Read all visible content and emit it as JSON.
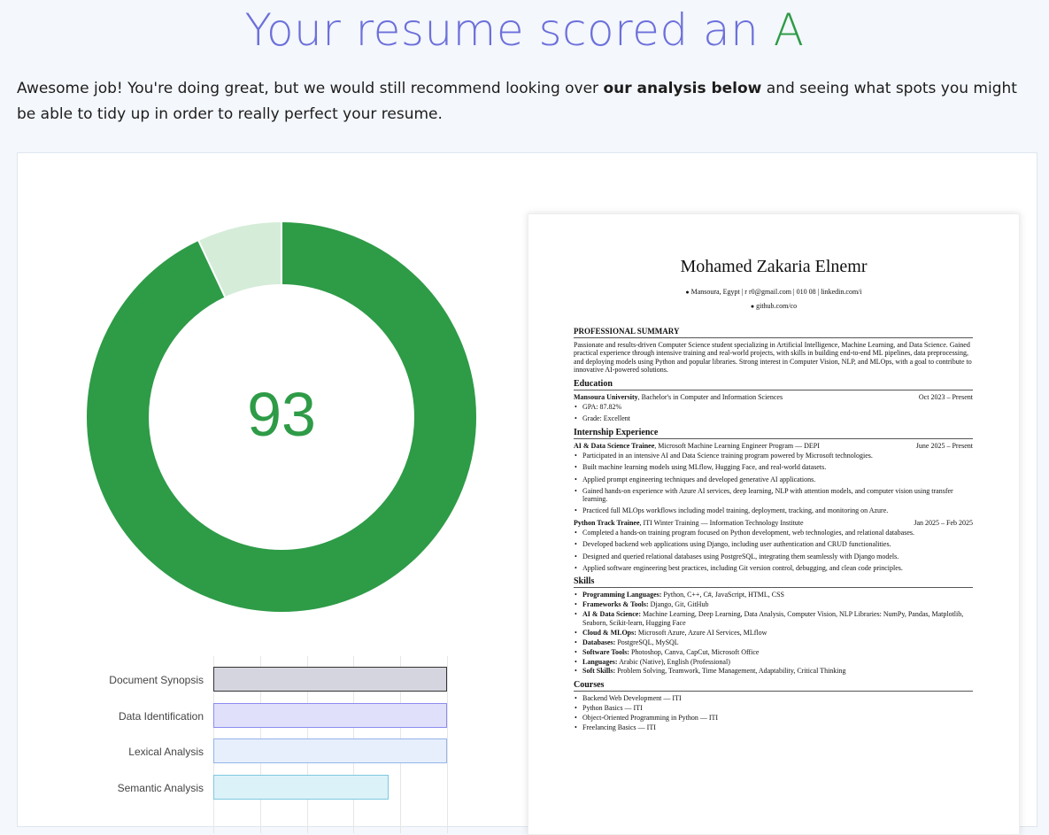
{
  "header": {
    "title_prefix": "Your resume scored an ",
    "grade": "A",
    "intro_before": "Awesome job! You're doing great, but we would still recommend looking over ",
    "intro_bold": "our analysis below",
    "intro_after": " and seeing what spots you might be able to tidy up in order to really perfect your resume."
  },
  "score": {
    "value": "93",
    "fraction": 0.93,
    "colors": {
      "fill": "#2e9b47",
      "remainder": "#d5ecd9"
    }
  },
  "bar_chart": {
    "chart_data": {
      "type": "bar",
      "orientation": "horizontal",
      "categories": [
        "Document Synopsis",
        "Data Identification",
        "Lexical Analysis",
        "Semantic Analysis"
      ],
      "values": [
        100,
        100,
        100,
        75
      ],
      "xlim": [
        0,
        100
      ],
      "grid": true,
      "colors": [
        {
          "fill": "#d5d5e0",
          "stroke": "#333333"
        },
        {
          "fill": "#e0e0fb",
          "stroke": "#8c8cf0"
        },
        {
          "fill": "#e7effc",
          "stroke": "#94b4e8"
        },
        {
          "fill": "#dbf2f8",
          "stroke": "#7fc8e0"
        }
      ]
    }
  },
  "resume": {
    "name": "Mohamed Zakaria Elnemr",
    "contact_line1": "Mansoura, Egypt |  r          r0@gmail.com |  010         08 |  linkedin.com/i",
    "contact_line2": "github.com/co",
    "summary_title": "PROFESSIONAL SUMMARY",
    "summary": "Passionate and results-driven Computer Science student specializing in Artificial Intelligence, Machine Learning, and Data Science. Gained practical experience through intensive training and real-world projects, with skills in building end-to-end ML pipelines, data preprocessing, and deploying models using Python and popular libraries. Strong interest in Computer Vision, NLP, and MLOps, with a goal to contribute to innovative AI-powered solutions.",
    "education_title": "Education",
    "edu_school": "Mansoura University",
    "edu_degree": ", Bachelor's in Computer and Information Sciences",
    "edu_date": "Oct 2023 – Present",
    "edu_gpa": "GPA: 87.82%",
    "edu_grade": "Grade: Excellent",
    "internship_title": "Internship Experience",
    "job1_role": "AI & Data Science Trainee",
    "job1_org": ", Microsoft Machine Learning Engineer Program — DEPI",
    "job1_date": "June 2025 – Present",
    "job1_points": [
      "Participated in an intensive AI and Data Science training program powered by Microsoft technologies.",
      "Built machine learning models using MLflow, Hugging Face, and real-world datasets.",
      "Applied prompt engineering techniques and developed generative AI applications.",
      "Gained hands-on experience with Azure AI services, deep learning, NLP with attention models, and computer vision using transfer learning.",
      "Practiced full MLOps workflows including model training, deployment, tracking, and monitoring on Azure."
    ],
    "job2_role": "Python Track Trainee",
    "job2_org": ", ITI Winter Training — Information Technology Institute",
    "job2_date": "Jan 2025 – Feb 2025",
    "job2_points": [
      "Completed a hands-on training program focused on Python development, web technologies, and relational databases.",
      "Developed backend web applications using Django, including user authentication and CRUD functionalities.",
      "Designed and queried relational databases using PostgreSQL, integrating them seamlessly with Django models.",
      "Applied software engineering best practices, including Git version control, debugging, and clean code principles."
    ],
    "skills_title": "Skills",
    "skills": [
      {
        "k": "Programming Languages:",
        "v": " Python, C++, C#, JavaScript, HTML, CSS"
      },
      {
        "k": "Frameworks & Tools:",
        "v": " Django, Git, GitHub"
      },
      {
        "k": "AI & Data Science:",
        "v": " Machine Learning, Deep Learning, Data Analysis, Computer Vision, NLP Libraries: NumPy, Pandas, Matplotlib, Seaborn, Scikit-learn, Hugging Face"
      },
      {
        "k": "Cloud & MLOps:",
        "v": " Microsoft Azure, Azure AI Services, MLflow"
      },
      {
        "k": "Databases:",
        "v": " PostgreSQL, MySQL"
      },
      {
        "k": "Software Tools:",
        "v": " Photoshop, Canva, CapCut, Microsoft Office"
      },
      {
        "k": "Languages:",
        "v": " Arabic (Native), English (Professional)"
      },
      {
        "k": "Soft Skills:",
        "v": " Problem Solving, Teamwork, Time Management, Adaptability, Critical Thinking"
      }
    ],
    "courses_title": "Courses",
    "courses": [
      "Backend Web Development — ITI",
      "Python Basics — ITI",
      "Object-Oriented Programming in Python — ITI",
      "Freelancing Basics — ITI"
    ]
  }
}
